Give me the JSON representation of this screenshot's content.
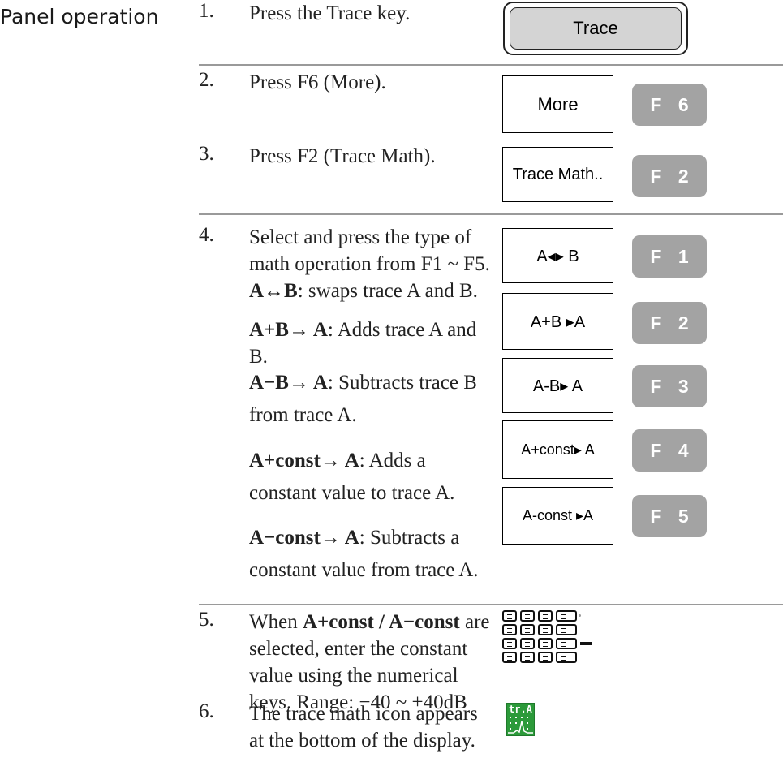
{
  "section": {
    "title": "Panel operation"
  },
  "steps": [
    {
      "num": "1.",
      "text": "Press the Trace key."
    },
    {
      "num": "2.",
      "text": "Press F6 (More)."
    },
    {
      "num": "3.",
      "text": "Press F2 (Trace Math)."
    },
    {
      "num": "4.",
      "text": "Select and press the type of math operation from F1 ~ F5."
    },
    {
      "num": "5.",
      "text_pre": "When ",
      "text_bold": "A+const / A−const",
      "text_post": " are selected, enter the constant value using the numerical keys. Range: −40 ~ +40dB"
    },
    {
      "num": "6.",
      "text": "The trace math icon appears at the bottom of the display."
    }
  ],
  "operations": [
    {
      "label": "A↔B",
      "desc": ": swaps trace A and B."
    },
    {
      "label": "A+B→ A",
      "desc": ": Adds trace A and B."
    },
    {
      "label": "A−B→ A",
      "desc": ": Subtracts trace B from trace A."
    },
    {
      "label": "A+const→ A",
      "desc": ": Adds a constant value to trace A."
    },
    {
      "label": "A−const→ A",
      "desc": ": Subtracts a constant value from trace A."
    }
  ],
  "keys": {
    "trace": "Trace",
    "more": "More",
    "trace_math": "Trace Math..",
    "ops": [
      "A◂▸ B",
      "A+B ▸A",
      "A-B▸ A",
      "A+const▸ A",
      "A-const ▸A"
    ]
  },
  "fkeys": [
    "F 6",
    "F 2",
    "F 1",
    "F 2",
    "F 3",
    "F 4",
    "F 5"
  ],
  "icons": {
    "keypad": "numeric-keypad-icon",
    "trace_math": "trace-math-icon"
  },
  "trace_math_icon": {
    "text": "tr.A"
  },
  "colors": {
    "fkey": "#a3a3a3",
    "divider": "#9a9a9a",
    "icon_green": "#2c9a3a"
  }
}
